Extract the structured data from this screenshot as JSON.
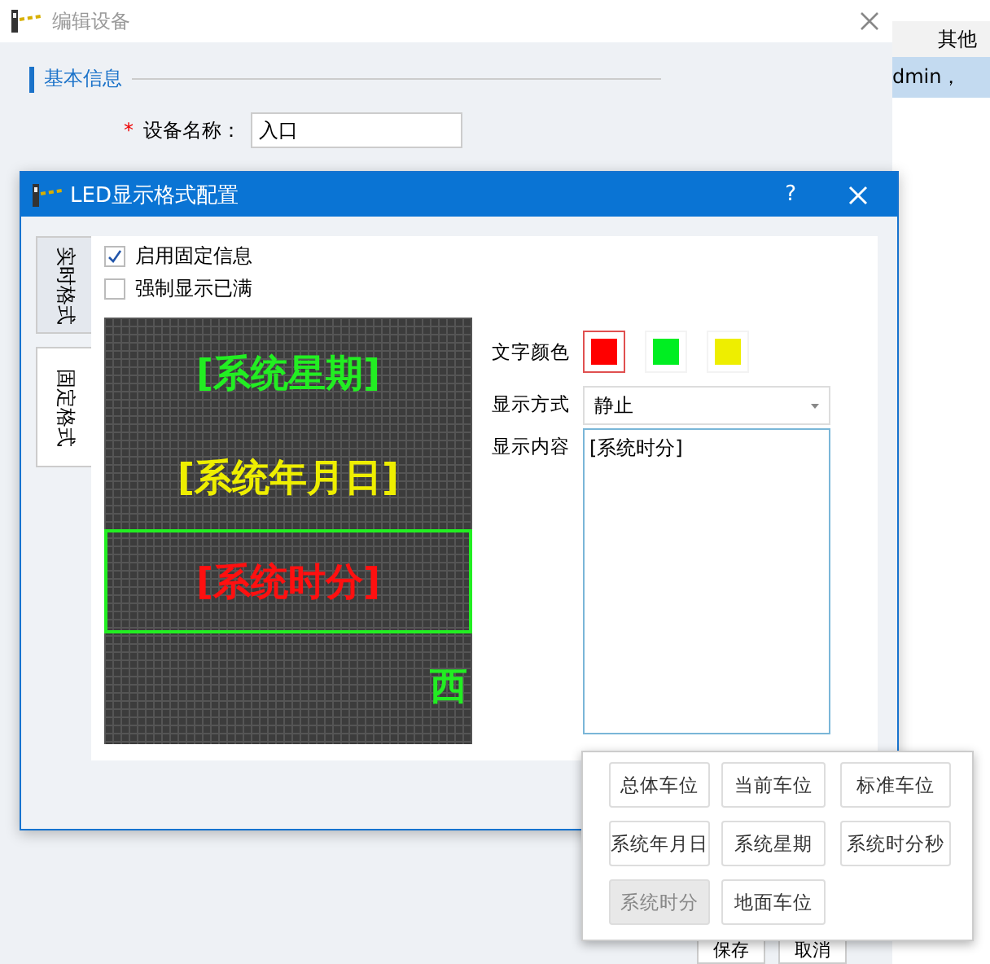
{
  "background_dialog": {
    "title": "编辑设备",
    "section": "基本信息",
    "fields": [
      {
        "required_mark": "*",
        "label": "设备名称：",
        "value": "入口"
      }
    ],
    "buttons": [
      "保存",
      "取消"
    ]
  },
  "background_table": {
    "column_header": "其他",
    "rows": [
      {
        "text": "dmin，",
        "selected": true
      }
    ]
  },
  "led_dialog": {
    "title": "LED显示格式配置",
    "help": "?",
    "tabs": [
      {
        "label": "实时格式",
        "selected": false
      },
      {
        "label": "固定格式",
        "selected": true
      }
    ],
    "checkboxes": [
      {
        "label": "启用固定信息",
        "checked": true
      },
      {
        "label": "强制显示已满",
        "checked": false
      }
    ],
    "led_lines": [
      {
        "text": "[系统星期]",
        "color": "#22ee22",
        "kind": "static",
        "selected": false
      },
      {
        "text": "[系统年月日]",
        "color": "#eeee00",
        "kind": "static",
        "selected": false
      },
      {
        "text": "[系统时分]",
        "color": "#ff1010",
        "kind": "static",
        "selected": true
      },
      {
        "text": "西",
        "color": "#22ee22",
        "kind": "scrolling",
        "selected": false
      }
    ],
    "text_color": {
      "label": "文字颜色",
      "options": [
        {
          "color": "#ff0000",
          "selected": true
        },
        {
          "color": "#00ee22",
          "selected": false
        },
        {
          "color": "#eeee00",
          "selected": false
        }
      ]
    },
    "display_mode": {
      "label": "显示方式",
      "value": "静止"
    },
    "content": {
      "label": "显示内容",
      "value": "[系统时分]"
    },
    "insert_menu": [
      {
        "label": "总体车位",
        "disabled": false
      },
      {
        "label": "当前车位",
        "disabled": false
      },
      {
        "label": "标准车位",
        "disabled": false
      },
      {
        "label": "系统年月日",
        "disabled": false
      },
      {
        "label": "系统星期",
        "disabled": false
      },
      {
        "label": "系统时分秒",
        "disabled": false
      },
      {
        "label": "系统时分",
        "disabled": true
      },
      {
        "label": "地面车位",
        "disabled": false
      }
    ]
  }
}
